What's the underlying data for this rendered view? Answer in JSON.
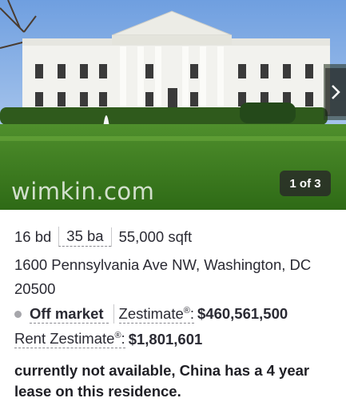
{
  "photo": {
    "watermark": "wimkin.com",
    "counter": "1 of 3",
    "next_icon": "chevron-right-icon"
  },
  "facts": {
    "beds": "16 bd",
    "baths": "35 ba",
    "sqft": "55,000 sqft"
  },
  "address": "1600 Pennsylvania Ave NW, Washington, DC 20500",
  "status": {
    "label": "Off market",
    "zestimate_label": "Zestimate",
    "zestimate_reg": "®",
    "zestimate_value": "$460,561,500",
    "dot_color": "#a6a6ab"
  },
  "rent": {
    "label": "Rent Zestimate",
    "reg": "®",
    "value": "$1,801,601"
  },
  "note": "currently not available, China has a 4 year lease on this residence."
}
